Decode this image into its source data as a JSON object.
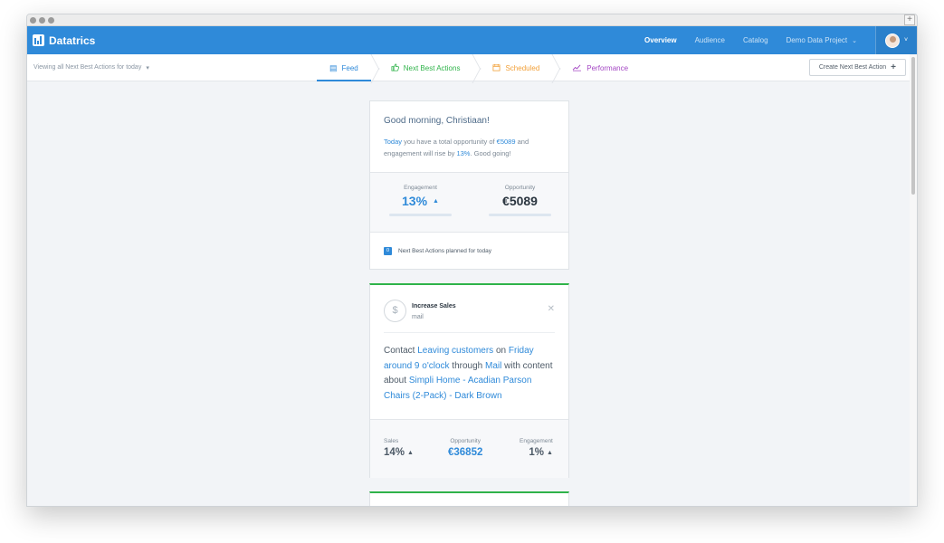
{
  "colors": {
    "primary": "#2f8ad9",
    "green": "#2fb34a",
    "orange": "#f2a13a",
    "purple": "#a447c4",
    "dark": "#2b3640"
  },
  "app": {
    "name": "Datatrics",
    "logo_icon": "bar-chart-logo-icon"
  },
  "topnav": {
    "items": [
      {
        "label": "Overview",
        "active": true
      },
      {
        "label": "Audience",
        "active": false
      },
      {
        "label": "Catalog",
        "active": false
      },
      {
        "label": "Demo Data Project",
        "active": false,
        "dropdown": true
      }
    ],
    "user_icon": "avatar",
    "user_chevron": "˅"
  },
  "subbar": {
    "viewing_label": "Viewing all Next Best Actions for today",
    "viewing_chevron": "▾",
    "tabs": [
      {
        "label": "Feed",
        "icon": "▤",
        "icon_name": "feed-icon"
      },
      {
        "label": "Next Best Actions",
        "icon": "👍",
        "icon_name": "thumbs-up-icon"
      },
      {
        "label": "Scheduled",
        "icon": "▦",
        "icon_name": "calendar-icon"
      },
      {
        "label": "Performance",
        "icon": "📈",
        "icon_name": "chart-line-icon"
      }
    ],
    "create_label": "Create Next Best Action",
    "create_icon": "+"
  },
  "greeting": {
    "title": "Good morning, Christiaan!",
    "text_1": "Today",
    "text_2": " you have a total opportunity of ",
    "text_3": "€5089",
    "text_4": " and engagement will rise by ",
    "text_5": "13%",
    "text_6": ". Good going!",
    "engagement_label": "Engagement",
    "engagement_value": "13%",
    "engagement_arrow": "▲",
    "opportunity_label": "Opportunity",
    "opportunity_value": "€5089",
    "planned_count": "0",
    "planned_label": "Next Best Actions planned for today"
  },
  "action": {
    "icon": "$",
    "title": "Increase Sales",
    "channel": "mail",
    "close_icon": "✕",
    "body": [
      {
        "text": "Contact ",
        "hl": false
      },
      {
        "text": "Leaving customers",
        "hl": true
      },
      {
        "text": " on ",
        "hl": false
      },
      {
        "text": "Friday around 9 o'clock",
        "hl": true
      },
      {
        "text": " through ",
        "hl": false
      },
      {
        "text": "Mail",
        "hl": true
      },
      {
        "text": " with content about ",
        "hl": false
      },
      {
        "text": "Simpli Home - Acadian Parson Chairs (2-Pack) - Dark Brown",
        "hl": true
      }
    ],
    "sales_label": "Sales",
    "sales_value": "14%",
    "opportunity_label": "Opportunity",
    "opportunity_value": "€36852",
    "engagement_label": "Engagement",
    "engagement_value": "1%",
    "arrow": "▲"
  },
  "window": {
    "plus": "+"
  }
}
